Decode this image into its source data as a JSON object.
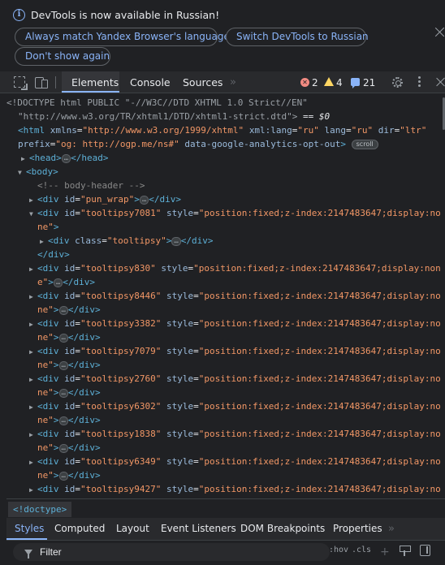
{
  "infobar": {
    "message": "DevTools is now available in Russian!",
    "buttons": {
      "match_language": "Always match Yandex Browser's language",
      "switch_language": "Switch DevTools to Russian",
      "dont_show": "Don't show again"
    }
  },
  "toolbar": {
    "tabs": [
      "Elements",
      "Console",
      "Sources"
    ],
    "active_tab": "Elements",
    "more_tabs": "»",
    "errors": "2",
    "warnings": "4",
    "messages": "21"
  },
  "dom": {
    "doctype_line1": "<!DOCTYPE html PUBLIC \"-//W3C//DTD XHTML 1.0 Strict//EN\"",
    "doctype_line2": "\"http://www.w3.org/TR/xhtml1/DTD/xhtml1-strict.dtd\">",
    "doctype_eq": "== $0",
    "html_tag": "html",
    "html_attrs": [
      {
        "name": "xmlns",
        "value": "\"http://www.w3.org/1999/xhtml\""
      },
      {
        "name": "xml:lang",
        "value": "\"ru\""
      },
      {
        "name": "lang",
        "value": "\"ru\""
      },
      {
        "name": "dir",
        "value": "\"ltr\""
      }
    ],
    "html_prefix_name": "prefix",
    "html_prefix_value": "\"og: http://ogp.me/ns#\"",
    "html_ga_attr": "data-google-analytics-opt-out",
    "scroll_badge": "scroll",
    "head_tag": "head",
    "body_tag": "body",
    "comment": "<!-- body-header -->",
    "pun_wrap_id": "\"pun_wrap\"",
    "tooltipsy_class": "\"tooltipsy\"",
    "style_value": "\"position:fixed;z-index:2147483647;display:no",
    "style_value_830": "\"position:fixed;z-index:2147483647;display:non",
    "style_tail": "ne\"",
    "style_tail_830": "e\"",
    "tooltip_ids": [
      "\"tooltipsy7081\"",
      "\"tooltipsy830\"",
      "\"tooltipsy8446\"",
      "\"tooltipsy3382\"",
      "\"tooltipsy7079\"",
      "\"tooltipsy2760\"",
      "\"tooltipsy6302\"",
      "\"tooltipsy1838\"",
      "\"tooltipsy6349\"",
      "\"tooltipsy9427\""
    ]
  },
  "breadcrumb": "<!doctype>",
  "sidebar_tabs": [
    "Styles",
    "Computed",
    "Layout",
    "Event Listeners",
    "DOM Breakpoints",
    "Properties"
  ],
  "filter": {
    "placeholder": "Filter",
    "hov": ":hov",
    "cls": ".cls",
    "plus": "+"
  }
}
